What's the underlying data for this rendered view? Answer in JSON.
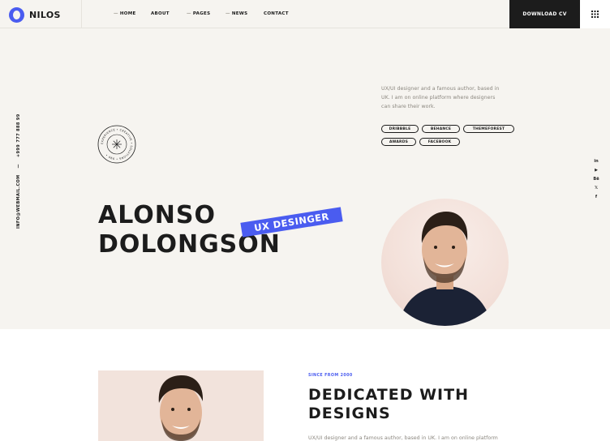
{
  "header": {
    "logo_text": "NILOS",
    "nav": [
      {
        "label": "HOME",
        "prefix": "—"
      },
      {
        "label": "ABOUT",
        "prefix": ""
      },
      {
        "label": "PAGES",
        "prefix": "—"
      },
      {
        "label": "NEWS",
        "prefix": "—"
      },
      {
        "label": "CONTACT",
        "prefix": ""
      }
    ],
    "cta_label": "DOWNLOAD CV",
    "menu_icon": "grid-menu-icon"
  },
  "hero": {
    "side_email": "INFO@WEBMAIL.COM",
    "side_separator": "—",
    "side_phone": "+999 777 888 99",
    "badge_text": "EXPERIENCE • CREATIVE • SOLUTIONS • 999 •",
    "intro": "UX/UI designer and a famous author, based in UK. I am on online platform where designers can share their work.",
    "tags": [
      "DRIBBBLE",
      "BEHANCE",
      "THEMEFOREST",
      "AWARDS",
      "FACEBOOK"
    ],
    "name_line1": "ALONSO",
    "name_line2": "DOLONGSON",
    "role": "UX DESINGER",
    "socials": [
      {
        "label": "in",
        "icon": "linkedin-icon"
      },
      {
        "label": "▶",
        "icon": "youtube-icon"
      },
      {
        "label": "Bē",
        "icon": "behance-icon"
      },
      {
        "label": "𝕏",
        "icon": "twitter-icon"
      },
      {
        "label": "f",
        "icon": "facebook-icon"
      }
    ]
  },
  "about": {
    "since": "SINCE FROM 2000",
    "title": "DEDICATED WITH DESIGNS",
    "text": "UX/UI designer and a famous author, based in UK. I am on online platform"
  },
  "colors": {
    "accent": "#4a5cf0",
    "dark": "#1c1c1c",
    "cream": "#f6f4f0"
  }
}
